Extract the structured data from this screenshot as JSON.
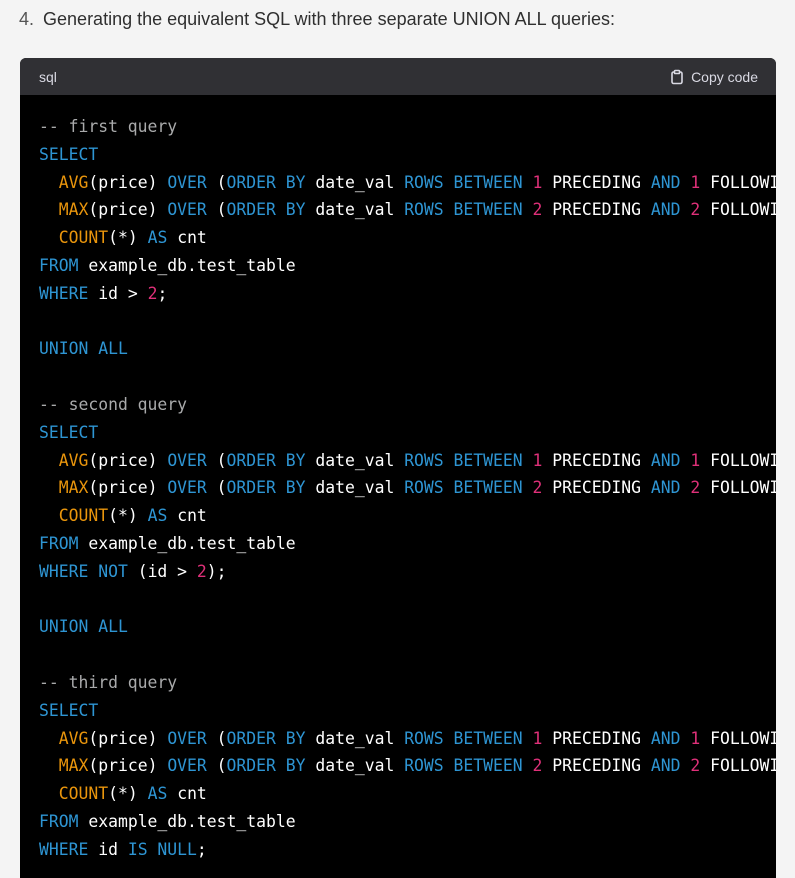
{
  "step": {
    "number": "4.",
    "text": "Generating the equivalent SQL with three separate UNION ALL queries:"
  },
  "code_block": {
    "language": "sql",
    "copy_label": "Copy code",
    "copy_icon": "clipboard-icon",
    "colors": {
      "background": "#000000",
      "header": "#303034",
      "keyword": "#2e95d3",
      "function": "#e9950c",
      "number": "#df3079",
      "comment": "#a9aaab",
      "plain": "#ffffff"
    },
    "lines": [
      [
        {
          "t": "cm",
          "v": "-- first query"
        }
      ],
      [
        {
          "t": "kw",
          "v": "SELECT"
        }
      ],
      [
        {
          "t": "plain",
          "v": "  "
        },
        {
          "t": "fn",
          "v": "AVG"
        },
        {
          "t": "plain",
          "v": "(price) "
        },
        {
          "t": "kw",
          "v": "OVER"
        },
        {
          "t": "plain",
          "v": " ("
        },
        {
          "t": "kw",
          "v": "ORDER BY"
        },
        {
          "t": "plain",
          "v": " date_val "
        },
        {
          "t": "kw",
          "v": "ROWS BETWEEN"
        },
        {
          "t": "plain",
          "v": " "
        },
        {
          "t": "num",
          "v": "1"
        },
        {
          "t": "plain",
          "v": " PRECEDING "
        },
        {
          "t": "kw",
          "v": "AND"
        },
        {
          "t": "plain",
          "v": " "
        },
        {
          "t": "num",
          "v": "1"
        },
        {
          "t": "plain",
          "v": " FOLLOWIN"
        }
      ],
      [
        {
          "t": "plain",
          "v": "  "
        },
        {
          "t": "fn",
          "v": "MAX"
        },
        {
          "t": "plain",
          "v": "(price) "
        },
        {
          "t": "kw",
          "v": "OVER"
        },
        {
          "t": "plain",
          "v": " ("
        },
        {
          "t": "kw",
          "v": "ORDER BY"
        },
        {
          "t": "plain",
          "v": " date_val "
        },
        {
          "t": "kw",
          "v": "ROWS BETWEEN"
        },
        {
          "t": "plain",
          "v": " "
        },
        {
          "t": "num",
          "v": "2"
        },
        {
          "t": "plain",
          "v": " PRECEDING "
        },
        {
          "t": "kw",
          "v": "AND"
        },
        {
          "t": "plain",
          "v": " "
        },
        {
          "t": "num",
          "v": "2"
        },
        {
          "t": "plain",
          "v": " FOLLOWIN"
        }
      ],
      [
        {
          "t": "plain",
          "v": "  "
        },
        {
          "t": "fn",
          "v": "COUNT"
        },
        {
          "t": "plain",
          "v": "(*) "
        },
        {
          "t": "kw",
          "v": "AS"
        },
        {
          "t": "plain",
          "v": " cnt"
        }
      ],
      [
        {
          "t": "kw",
          "v": "FROM"
        },
        {
          "t": "plain",
          "v": " example_db.test_table"
        }
      ],
      [
        {
          "t": "kw",
          "v": "WHERE"
        },
        {
          "t": "plain",
          "v": " id > "
        },
        {
          "t": "num",
          "v": "2"
        },
        {
          "t": "plain",
          "v": ";"
        }
      ],
      [],
      [
        {
          "t": "kw",
          "v": "UNION ALL"
        }
      ],
      [],
      [
        {
          "t": "cm",
          "v": "-- second query"
        }
      ],
      [
        {
          "t": "kw",
          "v": "SELECT"
        }
      ],
      [
        {
          "t": "plain",
          "v": "  "
        },
        {
          "t": "fn",
          "v": "AVG"
        },
        {
          "t": "plain",
          "v": "(price) "
        },
        {
          "t": "kw",
          "v": "OVER"
        },
        {
          "t": "plain",
          "v": " ("
        },
        {
          "t": "kw",
          "v": "ORDER BY"
        },
        {
          "t": "plain",
          "v": " date_val "
        },
        {
          "t": "kw",
          "v": "ROWS BETWEEN"
        },
        {
          "t": "plain",
          "v": " "
        },
        {
          "t": "num",
          "v": "1"
        },
        {
          "t": "plain",
          "v": " PRECEDING "
        },
        {
          "t": "kw",
          "v": "AND"
        },
        {
          "t": "plain",
          "v": " "
        },
        {
          "t": "num",
          "v": "1"
        },
        {
          "t": "plain",
          "v": " FOLLOWIN"
        }
      ],
      [
        {
          "t": "plain",
          "v": "  "
        },
        {
          "t": "fn",
          "v": "MAX"
        },
        {
          "t": "plain",
          "v": "(price) "
        },
        {
          "t": "kw",
          "v": "OVER"
        },
        {
          "t": "plain",
          "v": " ("
        },
        {
          "t": "kw",
          "v": "ORDER BY"
        },
        {
          "t": "plain",
          "v": " date_val "
        },
        {
          "t": "kw",
          "v": "ROWS BETWEEN"
        },
        {
          "t": "plain",
          "v": " "
        },
        {
          "t": "num",
          "v": "2"
        },
        {
          "t": "plain",
          "v": " PRECEDING "
        },
        {
          "t": "kw",
          "v": "AND"
        },
        {
          "t": "plain",
          "v": " "
        },
        {
          "t": "num",
          "v": "2"
        },
        {
          "t": "plain",
          "v": " FOLLOWIN"
        }
      ],
      [
        {
          "t": "plain",
          "v": "  "
        },
        {
          "t": "fn",
          "v": "COUNT"
        },
        {
          "t": "plain",
          "v": "(*) "
        },
        {
          "t": "kw",
          "v": "AS"
        },
        {
          "t": "plain",
          "v": " cnt"
        }
      ],
      [
        {
          "t": "kw",
          "v": "FROM"
        },
        {
          "t": "plain",
          "v": " example_db.test_table"
        }
      ],
      [
        {
          "t": "kw",
          "v": "WHERE"
        },
        {
          "t": "plain",
          "v": " "
        },
        {
          "t": "kw",
          "v": "NOT"
        },
        {
          "t": "plain",
          "v": " (id > "
        },
        {
          "t": "num",
          "v": "2"
        },
        {
          "t": "plain",
          "v": ");"
        }
      ],
      [],
      [
        {
          "t": "kw",
          "v": "UNION ALL"
        }
      ],
      [],
      [
        {
          "t": "cm",
          "v": "-- third query"
        }
      ],
      [
        {
          "t": "kw",
          "v": "SELECT"
        }
      ],
      [
        {
          "t": "plain",
          "v": "  "
        },
        {
          "t": "fn",
          "v": "AVG"
        },
        {
          "t": "plain",
          "v": "(price) "
        },
        {
          "t": "kw",
          "v": "OVER"
        },
        {
          "t": "plain",
          "v": " ("
        },
        {
          "t": "kw",
          "v": "ORDER BY"
        },
        {
          "t": "plain",
          "v": " date_val "
        },
        {
          "t": "kw",
          "v": "ROWS BETWEEN"
        },
        {
          "t": "plain",
          "v": " "
        },
        {
          "t": "num",
          "v": "1"
        },
        {
          "t": "plain",
          "v": " PRECEDING "
        },
        {
          "t": "kw",
          "v": "AND"
        },
        {
          "t": "plain",
          "v": " "
        },
        {
          "t": "num",
          "v": "1"
        },
        {
          "t": "plain",
          "v": " FOLLOWIN"
        }
      ],
      [
        {
          "t": "plain",
          "v": "  "
        },
        {
          "t": "fn",
          "v": "MAX"
        },
        {
          "t": "plain",
          "v": "(price) "
        },
        {
          "t": "kw",
          "v": "OVER"
        },
        {
          "t": "plain",
          "v": " ("
        },
        {
          "t": "kw",
          "v": "ORDER BY"
        },
        {
          "t": "plain",
          "v": " date_val "
        },
        {
          "t": "kw",
          "v": "ROWS BETWEEN"
        },
        {
          "t": "plain",
          "v": " "
        },
        {
          "t": "num",
          "v": "2"
        },
        {
          "t": "plain",
          "v": " PRECEDING "
        },
        {
          "t": "kw",
          "v": "AND"
        },
        {
          "t": "plain",
          "v": " "
        },
        {
          "t": "num",
          "v": "2"
        },
        {
          "t": "plain",
          "v": " FOLLOWIN"
        }
      ],
      [
        {
          "t": "plain",
          "v": "  "
        },
        {
          "t": "fn",
          "v": "COUNT"
        },
        {
          "t": "plain",
          "v": "(*) "
        },
        {
          "t": "kw",
          "v": "AS"
        },
        {
          "t": "plain",
          "v": " cnt"
        }
      ],
      [
        {
          "t": "kw",
          "v": "FROM"
        },
        {
          "t": "plain",
          "v": " example_db.test_table"
        }
      ],
      [
        {
          "t": "kw",
          "v": "WHERE"
        },
        {
          "t": "plain",
          "v": " id "
        },
        {
          "t": "kw",
          "v": "IS NULL"
        },
        {
          "t": "plain",
          "v": ";"
        }
      ]
    ]
  }
}
